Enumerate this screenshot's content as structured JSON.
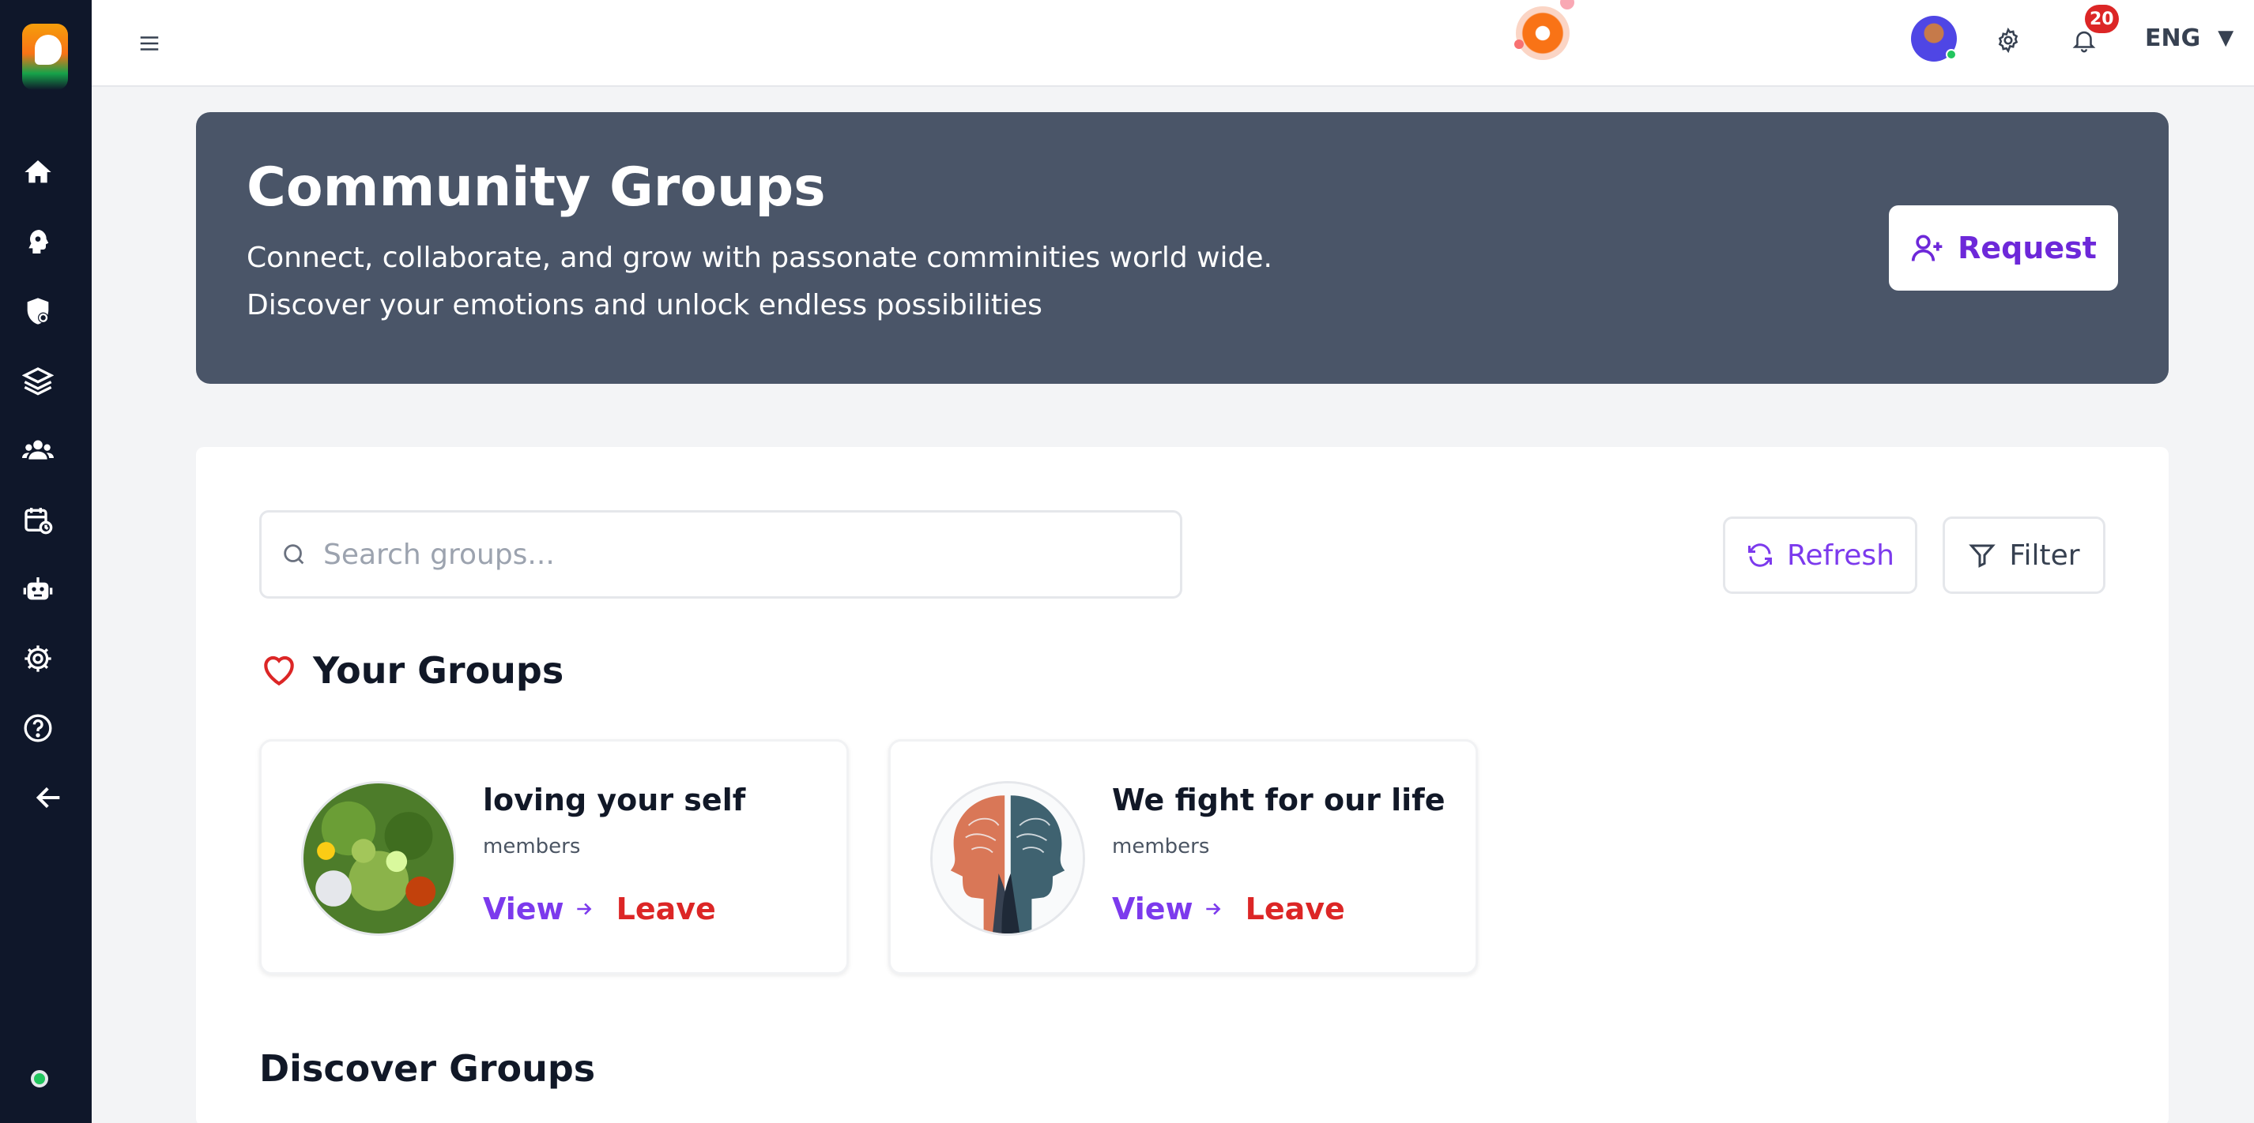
{
  "topbar": {
    "notification_count": "20",
    "language": "ENG"
  },
  "hero": {
    "title": "Community Groups",
    "subtitle_line1": "Connect, collaborate, and grow with passonate comminities world wide.",
    "subtitle_line2": "Discover your emotions and unlock endless possibilities",
    "request_label": "Request"
  },
  "search": {
    "placeholder": "Search groups..."
  },
  "toolbar": {
    "refresh_label": "Refresh",
    "filter_label": "Filter"
  },
  "your_groups": {
    "title": "Your Groups",
    "items": [
      {
        "name": "loving your self",
        "members": "members",
        "view_label": "View",
        "leave_label": "Leave"
      },
      {
        "name": "We fight for our life",
        "members": "members",
        "view_label": "View",
        "leave_label": "Leave"
      }
    ]
  },
  "discover": {
    "title": "Discover Groups"
  },
  "sidebar": {
    "icons": [
      "home-icon",
      "brain-icon",
      "shield-icon",
      "layers-icon",
      "users-icon",
      "calendar-icon",
      "robot-icon",
      "settings-icon",
      "help-icon",
      "back-arrow-icon"
    ]
  },
  "colors": {
    "accent": "#7c3aed",
    "danger": "#dc2626",
    "hero_bg": "#4a5568",
    "sidebar_bg": "#0f172a"
  }
}
